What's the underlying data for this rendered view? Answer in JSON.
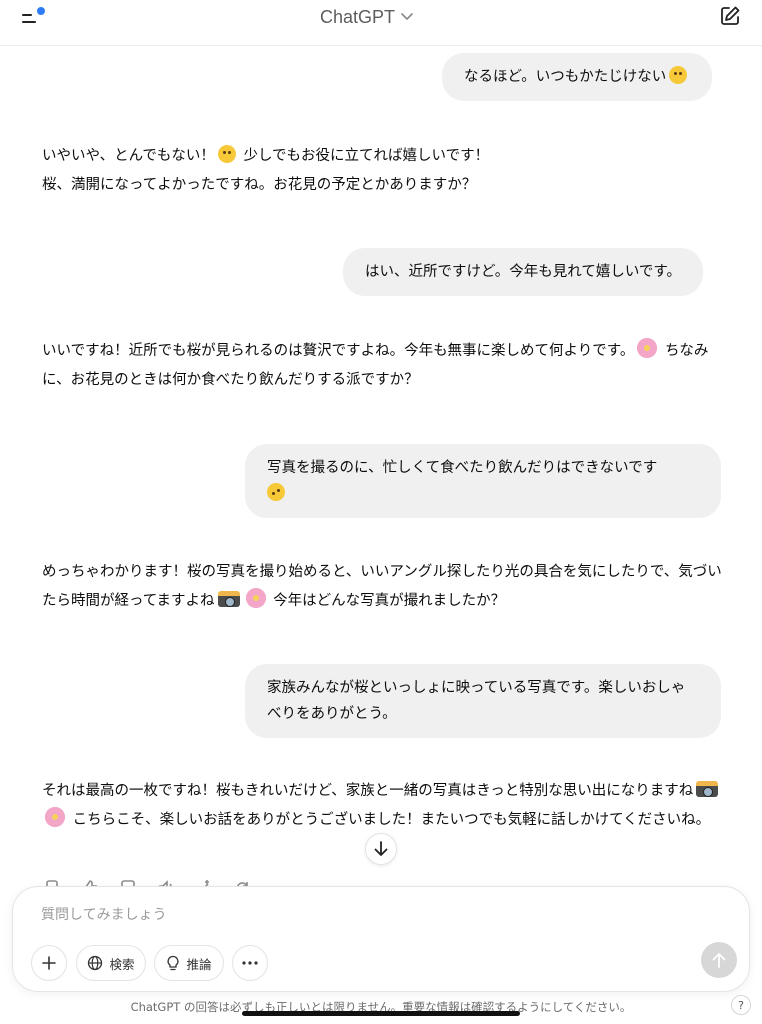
{
  "header": {
    "title": "ChatGPT",
    "menu_icon": "sidebar-menu-icon",
    "new_chat_icon": "compose-icon",
    "badge_color": "#2f7df6"
  },
  "messages": [
    {
      "role": "user",
      "text": "なるほど。いつもかたじけない",
      "emoji": "grinning-sweat"
    },
    {
      "role": "assistant",
      "lines": [
        {
          "text_a": "いやいや、とんでもない！",
          "emoji": "laughing",
          "text_b": "少しでもお役に立てれば嬉しいです！"
        },
        {
          "text_a": "桜、満開になってよかったですね。お花見の予定とかありますか？"
        }
      ]
    },
    {
      "role": "user",
      "text": "はい、近所ですけど。今年も見れて嬉しいです。"
    },
    {
      "role": "assistant",
      "text_a": "いいですね！近所でも桜が見られるのは贅沢ですよね。今年も無事に楽しめて何よりです。",
      "emoji": "cherry-blossom",
      "text_b": "ちなみに、お花見のときは何か食べたり飲んだりする派ですか？"
    },
    {
      "role": "user",
      "text": "写真を撮るのに、忙しくて食べたり飲んだりはできないです",
      "emoji": "crying"
    },
    {
      "role": "assistant",
      "text_a": "めっちゃわかります！桜の写真を撮り始めると、いいアングル探したり光の具合を気にしたりで、気づいたら時間が経ってますよね",
      "emojis": [
        "camera-flash",
        "cherry-blossom"
      ],
      "text_b": "今年はどんな写真が撮れましたか？"
    },
    {
      "role": "user",
      "text": "家族みんなが桜といっしょに映っている写真です。楽しいおしゃべりをありがとう。"
    },
    {
      "role": "assistant",
      "text_a": "それは最高の一枚ですね！桜もきれいだけど、家族と一緒の写真はきっと特別な思い出になりますね",
      "emojis": [
        "camera-flash",
        "cherry-blossom"
      ],
      "text_b": "こちらこそ、楽しいお話をありがとうございました！またいつでも気軽に話しかけてくださいね。"
    }
  ],
  "message_actions": [
    "copy-icon",
    "thumbs-up-icon",
    "thumbs-down-icon",
    "speaker-icon",
    "sparkle-edit-icon",
    "regenerate-icon"
  ],
  "composer": {
    "placeholder": "質問してみましょう",
    "search_label": "検索",
    "reason_label": "推論"
  },
  "footer": {
    "disclaimer": "ChatGPT の回答は必ずしも正しいとは限りません。重要な情報は確認するようにしてください。",
    "help": "?"
  }
}
